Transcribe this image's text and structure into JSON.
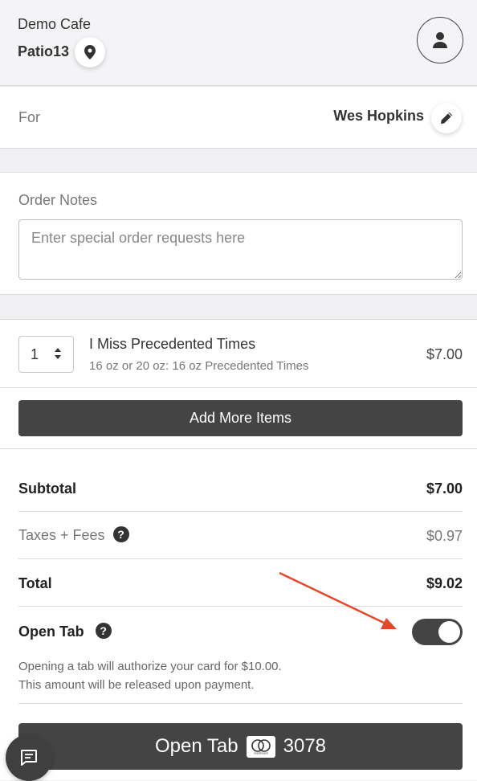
{
  "header": {
    "cafe_name": "Demo Cafe",
    "table_name": "Patio13"
  },
  "guest": {
    "for_label": "For",
    "name": "Wes Hopkins"
  },
  "notes": {
    "label": "Order Notes",
    "placeholder": "Enter special order requests here",
    "value": ""
  },
  "order": {
    "items": [
      {
        "quantity": "1",
        "name": "I Miss Precedented Times",
        "modifier": "16 oz or 20 oz: 16 oz Precedented Times",
        "price": "$7.00"
      }
    ],
    "add_more_label": "Add More Items"
  },
  "totals": {
    "subtotal_label": "Subtotal",
    "subtotal_value": "$7.00",
    "taxes_label": "Taxes + Fees",
    "taxes_value": "$0.97",
    "total_label": "Total",
    "total_value": "$9.02"
  },
  "open_tab": {
    "label": "Open Tab",
    "enabled": true,
    "note_line1": "Opening a tab will authorize your card for $10.00.",
    "note_line2": "This amount will be released upon payment.",
    "button_label": "Open Tab",
    "card_last4": "3078",
    "card_brand_text": "mastercard"
  },
  "icons": {
    "help": "?"
  },
  "colors": {
    "button_bg": "#444444",
    "annotation_arrow": "#e8462a"
  }
}
